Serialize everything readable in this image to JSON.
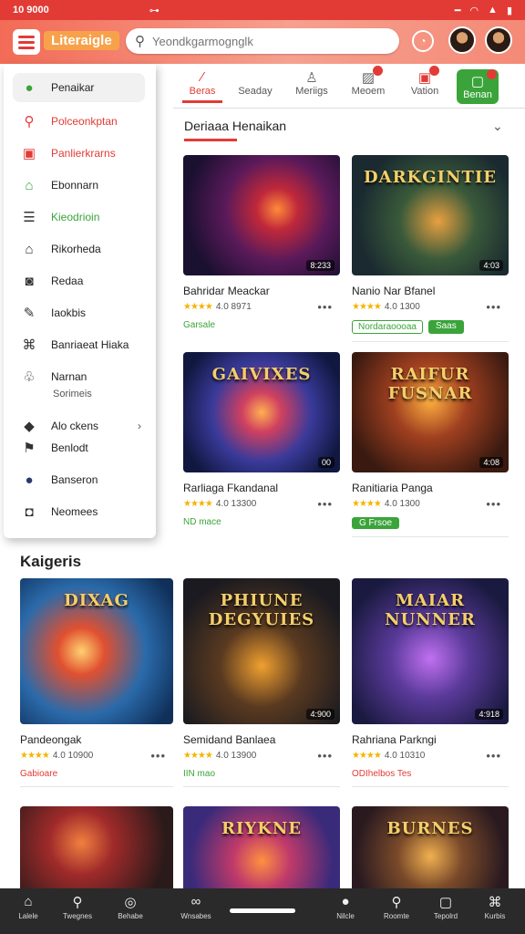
{
  "status": {
    "time": "10 9000"
  },
  "appbar": {
    "title": "Literaigle",
    "search_placeholder": "Yeondkgarmognglk"
  },
  "drawer": {
    "items": [
      {
        "label": "Penaikar"
      },
      {
        "label": "Polceonkptan"
      },
      {
        "label": "Panlierkrarns"
      },
      {
        "label": "Ebonnarn"
      },
      {
        "label": "Kieodrioin"
      },
      {
        "label": "Rikorheda"
      },
      {
        "label": "Redaa"
      },
      {
        "label": "Iaokbis"
      },
      {
        "label": "Banriaeat Hiaka"
      },
      {
        "label": "Narnan",
        "sub": "Sorimeis"
      },
      {
        "label": "Alo ckens"
      },
      {
        "label": "Benlodt"
      },
      {
        "label": "Banseron"
      },
      {
        "label": "Neomees"
      }
    ]
  },
  "tabs": [
    {
      "label": "Beras"
    },
    {
      "label": "Seaday"
    },
    {
      "label": "Meriigs"
    },
    {
      "label": "Meoem"
    },
    {
      "label": "Vation"
    },
    {
      "label": "Benan"
    }
  ],
  "section": {
    "title": "Deriaaa Henaikan"
  },
  "categories_title": "Kaigeris",
  "cards": [
    {
      "thumb_title": "",
      "duration": "8:233",
      "title": "Bahridar Meackar",
      "rating": "4.0",
      "meta": "8971",
      "tags": [
        "Garsale"
      ]
    },
    {
      "thumb_title": "DARKGINTIE",
      "duration": "4:03",
      "title": "Nanio Nar Bfanel",
      "rating": "4.0",
      "meta": "1300",
      "tags": [
        "Nordaraoooaa",
        "Saas"
      ]
    },
    {
      "thumb_title": "GAIVIXES",
      "duration": "00",
      "title": "Rarliaga Fkandanal",
      "rating": "4.0",
      "meta": "13300",
      "tags": [
        "ND mace"
      ]
    },
    {
      "thumb_title": "RAIFUR FUSNAR",
      "duration": "4:08",
      "title": "Ranitiaria Panga",
      "rating": "4.0",
      "meta": "1300",
      "tags": [
        "G Frsoe"
      ]
    },
    {
      "thumb_title": "DIXAG",
      "duration": "",
      "title": "Pandeongak",
      "rating": "4.0",
      "meta": "10900",
      "tags": [
        "Gabioare"
      ]
    },
    {
      "thumb_title": "PHIUNE DEGYUIES",
      "duration": "4:900",
      "title": "Semidand Banlaea",
      "rating": "4.0",
      "meta": "13900",
      "tags": [
        "IIN mao"
      ]
    },
    {
      "thumb_title": "MAIAR NUNNER",
      "duration": "4:918",
      "title": "Rahriana Parkngi",
      "rating": "4.0",
      "meta": "10310",
      "tags": [
        "ODIhelbos Tes"
      ]
    },
    {
      "thumb_title": "",
      "duration": "",
      "title": "",
      "rating": "",
      "meta": "",
      "tags": []
    },
    {
      "thumb_title": "RIYKNE",
      "duration": "",
      "title": "",
      "rating": "",
      "meta": "",
      "tags": []
    },
    {
      "thumb_title": "BURNES",
      "duration": "",
      "title": "",
      "rating": "",
      "meta": "",
      "tags": []
    }
  ],
  "bottom_nav": [
    {
      "label": "Lalele"
    },
    {
      "label": "Twegnes"
    },
    {
      "label": "Behabe"
    },
    {
      "label": "Wnsabes"
    },
    {
      "label": "Nilcle"
    },
    {
      "label": "Roomte"
    },
    {
      "label": "Tepolrd"
    },
    {
      "label": "Kurbis"
    }
  ]
}
